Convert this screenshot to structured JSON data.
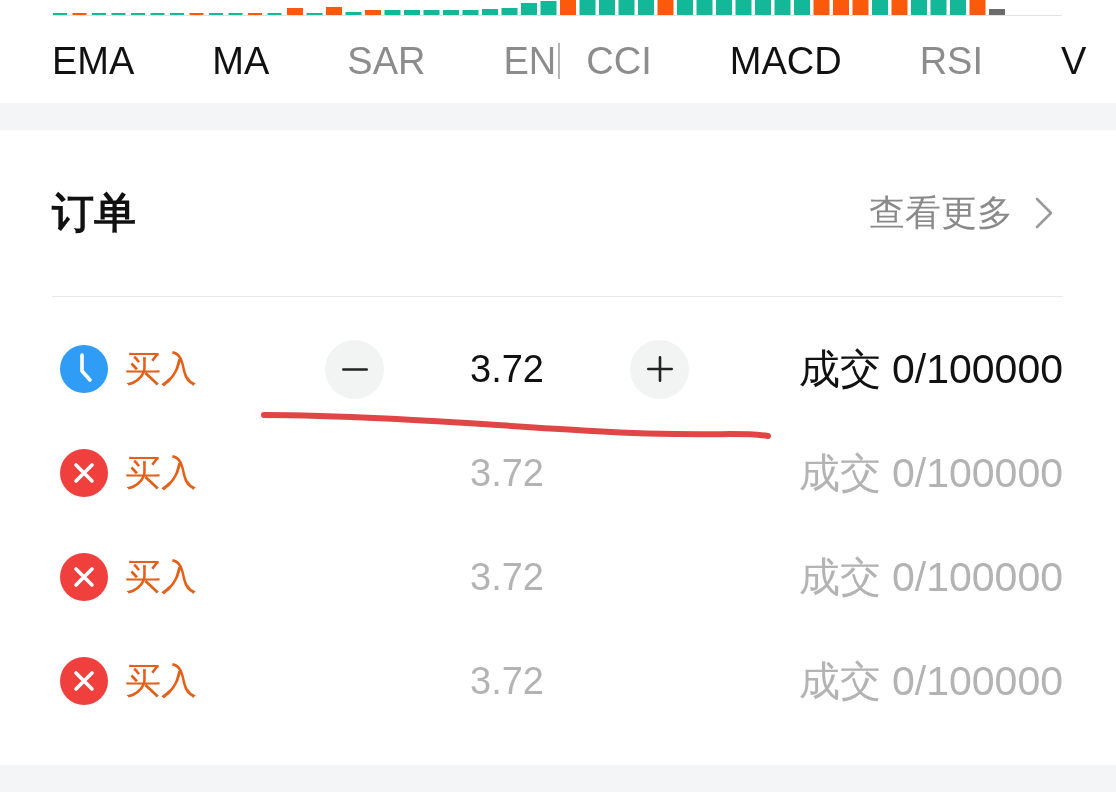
{
  "main_indicators": [
    {
      "label": "EMA",
      "selected": true
    },
    {
      "label": "MA",
      "selected": true
    },
    {
      "label": "SAR",
      "selected": false
    },
    {
      "label": "EN",
      "selected": false
    }
  ],
  "sub_indicators": [
    {
      "label": "CCI",
      "selected": false
    },
    {
      "label": "MACD",
      "selected": true
    },
    {
      "label": "RSI",
      "selected": false
    },
    {
      "label": "V",
      "selected": true
    }
  ],
  "orders": {
    "title": "订单",
    "more_link": "查看更多",
    "rows": [
      {
        "cancelled": false,
        "side": "买入",
        "price": "3.72",
        "filled": "成交 0/100000",
        "editing": true
      },
      {
        "cancelled": true,
        "side": "买入",
        "price": "3.72",
        "filled": "成交 0/100000",
        "editing": false
      },
      {
        "cancelled": true,
        "side": "买入",
        "price": "3.72",
        "filled": "成交 0/100000",
        "editing": false
      },
      {
        "cancelled": true,
        "side": "买入",
        "price": "3.72",
        "filled": "成交 0/100000",
        "editing": false
      }
    ]
  }
}
